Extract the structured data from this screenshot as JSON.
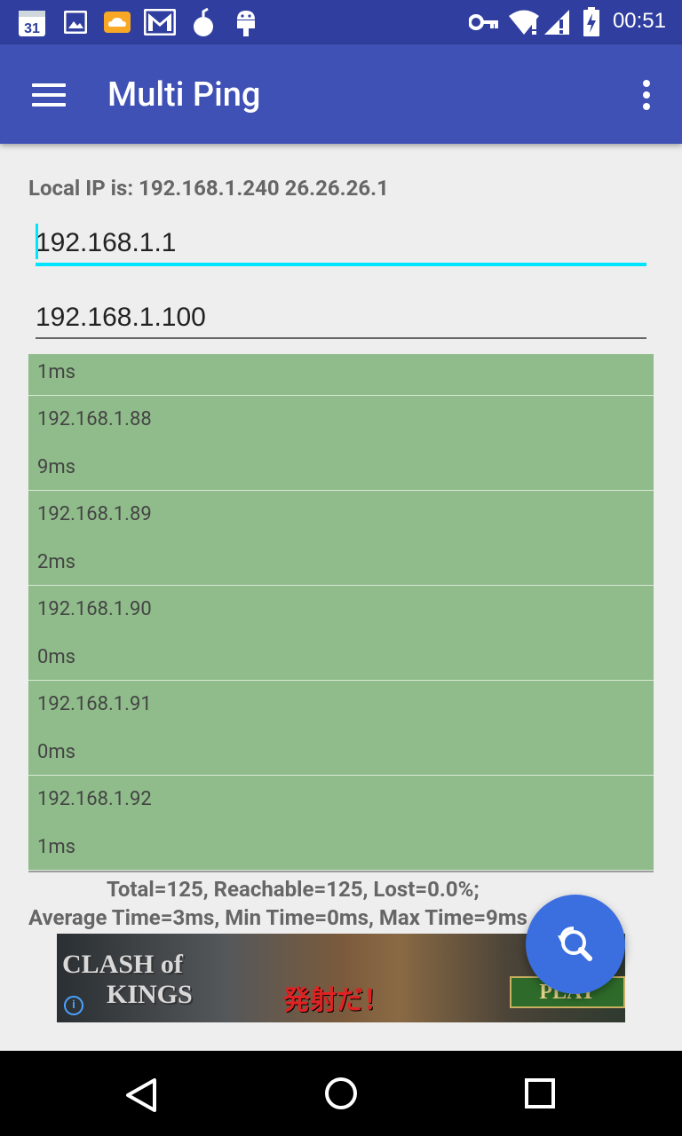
{
  "status_bar": {
    "time": "00:51",
    "calendar_day": "31",
    "left_icons": [
      "calendar-icon",
      "gallery-icon",
      "weather-icon",
      "gmail-icon",
      "bomb-icon",
      "android-icon"
    ],
    "right_icons": [
      "vpn-key-icon",
      "wifi-icon",
      "signal-icon",
      "battery-charging-icon"
    ]
  },
  "app_bar": {
    "title": "Multi Ping",
    "color": "#3f51b5",
    "status_color": "#303f9f"
  },
  "form": {
    "local_ip_text": "Local IP is: 192.168.1.240 26.26.26.1",
    "start_ip": "192.168.1.1",
    "end_ip": "192.168.1.100"
  },
  "results": {
    "top_partial_time": "1ms",
    "items": [
      {
        "ip": "192.168.1.88",
        "time": "9ms"
      },
      {
        "ip": "192.168.1.89",
        "time": "2ms"
      },
      {
        "ip": "192.168.1.90",
        "time": "0ms"
      },
      {
        "ip": "192.168.1.91",
        "time": "0ms"
      },
      {
        "ip": "192.168.1.92",
        "time": "1ms"
      }
    ],
    "row_color": "#8fbc8a"
  },
  "summary": {
    "line1": "Total=125, Reachable=125, Lost=0.0%;",
    "line2": "Average Time=3ms, Min Time=0ms, Max Time=9ms"
  },
  "ad": {
    "logo_line1": "CLASH of",
    "logo_line2": "KINGS",
    "tagline": "発射だ！",
    "play_label": "PLAY",
    "info_label": "i"
  },
  "fab": {
    "icon": "search-refresh-icon",
    "color": "#3b6fe0"
  },
  "nav_bar": {
    "buttons": [
      "back-icon",
      "home-icon",
      "recents-icon"
    ]
  }
}
